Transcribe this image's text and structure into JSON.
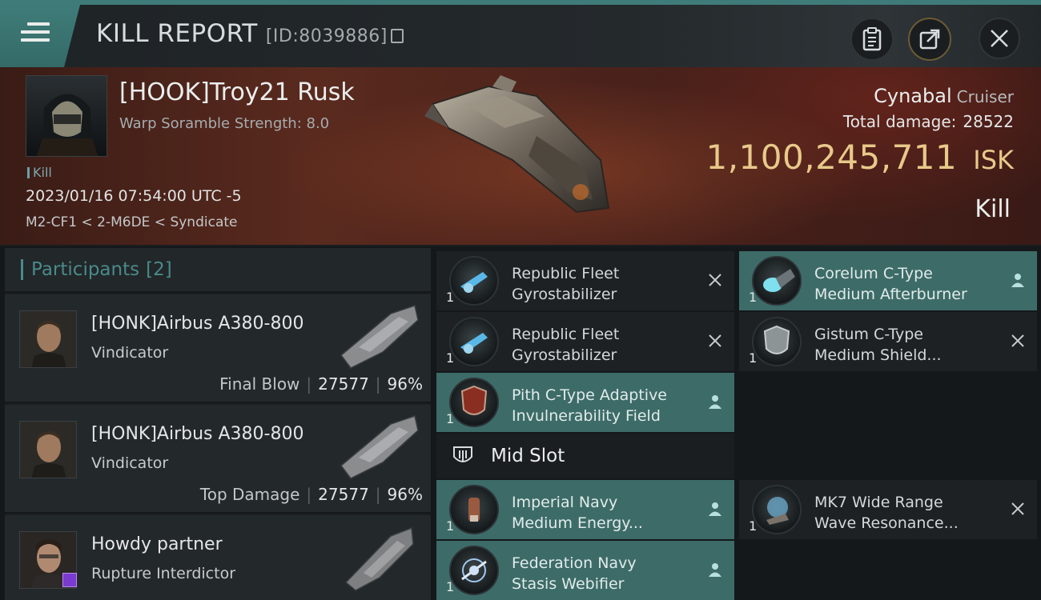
{
  "header": {
    "title": "KILL REPORT",
    "report_id": "[ID:8039886]",
    "menu_icon": "menu-icon",
    "buttons": [
      "clipboard-icon",
      "share-icon",
      "close-icon"
    ]
  },
  "victim": {
    "name": "[HOOK]Troy21 Rusk",
    "scramble": "Warp Soramble Strength: 8.0",
    "tag": "Kill",
    "time": "2023/01/16 07:54:00 UTC -5",
    "location": "M2-CF1 < 2-M6DE < Syndicate",
    "ship_name": "Cynabal",
    "ship_class": "Cruiser",
    "damage_label": "Total damage:",
    "damage_value": "28522",
    "isk_value": "1,100,245,711",
    "isk_unit": "ISK",
    "result": "Kill"
  },
  "participants": {
    "title": "Participants",
    "count": "[2]",
    "rows": [
      {
        "name": "[HONK]Airbus A380-800",
        "ship": "Vindicator",
        "role": "Final Blow",
        "damage": "27577",
        "percent": "96%"
      },
      {
        "name": "[HONK]Airbus A380-800",
        "ship": "Vindicator",
        "role": "Top Damage",
        "damage": "27577",
        "percent": "96%"
      },
      {
        "name": "Howdy partner",
        "ship": "Rupture Interdictor"
      }
    ]
  },
  "modules": {
    "mid_slot_label": "Mid Slot",
    "low": [
      {
        "qty": "1",
        "name1": "Republic Fleet",
        "name2": "Gyrostabilizer",
        "state": "destroyed"
      },
      {
        "qty": "1",
        "name1": "Corelum C-Type",
        "name2": "Medium Afterburner",
        "state": "dropped"
      },
      {
        "qty": "1",
        "name1": "Republic Fleet",
        "name2": "Gyrostabilizer",
        "state": "destroyed"
      },
      {
        "qty": "1",
        "name1": "Gistum C-Type",
        "name2": "Medium Shield...",
        "state": "destroyed"
      },
      {
        "qty": "1",
        "name1": "Pith C-Type Adaptive",
        "name2": "Invulnerability Field",
        "state": "dropped"
      }
    ],
    "mid": [
      {
        "qty": "1",
        "name1": "Imperial Navy",
        "name2": "Medium Energy...",
        "state": "dropped"
      },
      {
        "qty": "1",
        "name1": "MK7 Wide Range",
        "name2": "Wave Resonance...",
        "state": "destroyed"
      },
      {
        "qty": "1",
        "name1": "Federation Navy",
        "name2": "Stasis Webifier",
        "state": "dropped"
      }
    ]
  },
  "colors": {
    "accent_teal": "#3f7c79",
    "isk_gold": "#e8c98a",
    "dropped_bg": "#3d6b68",
    "destroyed_bg": "#1d2124"
  }
}
